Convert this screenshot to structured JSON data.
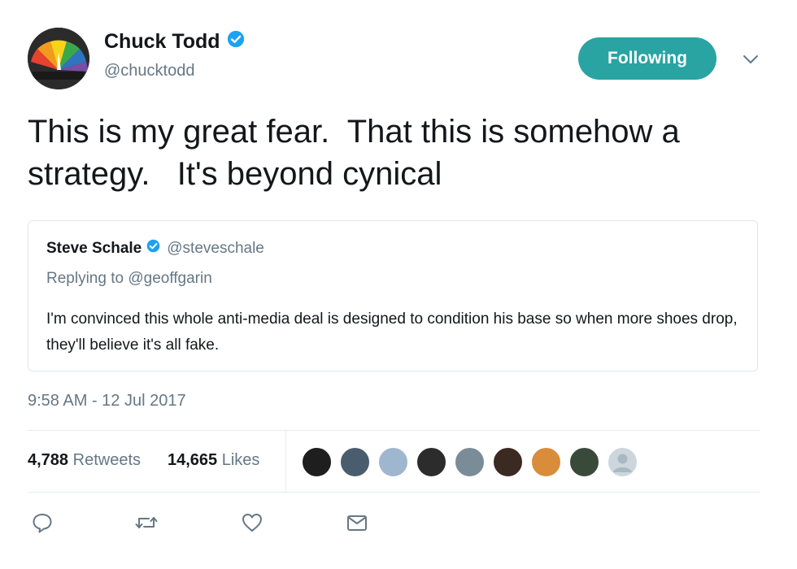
{
  "author": {
    "name": "Chuck Todd",
    "handle": "@chucktodd",
    "verified": true,
    "avatar_icon": "nbc-peacock-avatar"
  },
  "follow_button": {
    "label": "Following",
    "color": "#2aa3a3"
  },
  "tweet": {
    "text": "This is my great fear.  That this is somehow a strategy.   It's beyond cynical"
  },
  "quoted_tweet": {
    "name": "Steve Schale",
    "handle": "@steveschale",
    "verified": true,
    "replying_to": "Replying to @geoffgarin",
    "text": "I'm convinced this whole anti-media deal is designed to condition his base so when more shoes drop, they'll believe it's all fake."
  },
  "timestamp": "9:58 AM - 12 Jul 2017",
  "stats": {
    "retweets_count": "4,788",
    "retweets_label": "Retweets",
    "likes_count": "14,665",
    "likes_label": "Likes"
  },
  "liker_avatars": [
    {
      "color": "#1e1e1e"
    },
    {
      "color": "#4a5d6e"
    },
    {
      "color": "#9fb6cf"
    },
    {
      "color": "#2c2c2c"
    },
    {
      "color": "#7a8c97"
    },
    {
      "color": "#3b2a22"
    },
    {
      "color": "#d98c3a"
    },
    {
      "color": "#3a4a3a"
    },
    {
      "color": "#ccd6dd"
    }
  ],
  "actions": [
    "reply-icon",
    "retweet-icon",
    "like-icon",
    "direct-message-icon"
  ],
  "colors": {
    "verified_blue": "#1da1f2",
    "secondary_text": "#657786",
    "divider": "#e6ecf0"
  }
}
